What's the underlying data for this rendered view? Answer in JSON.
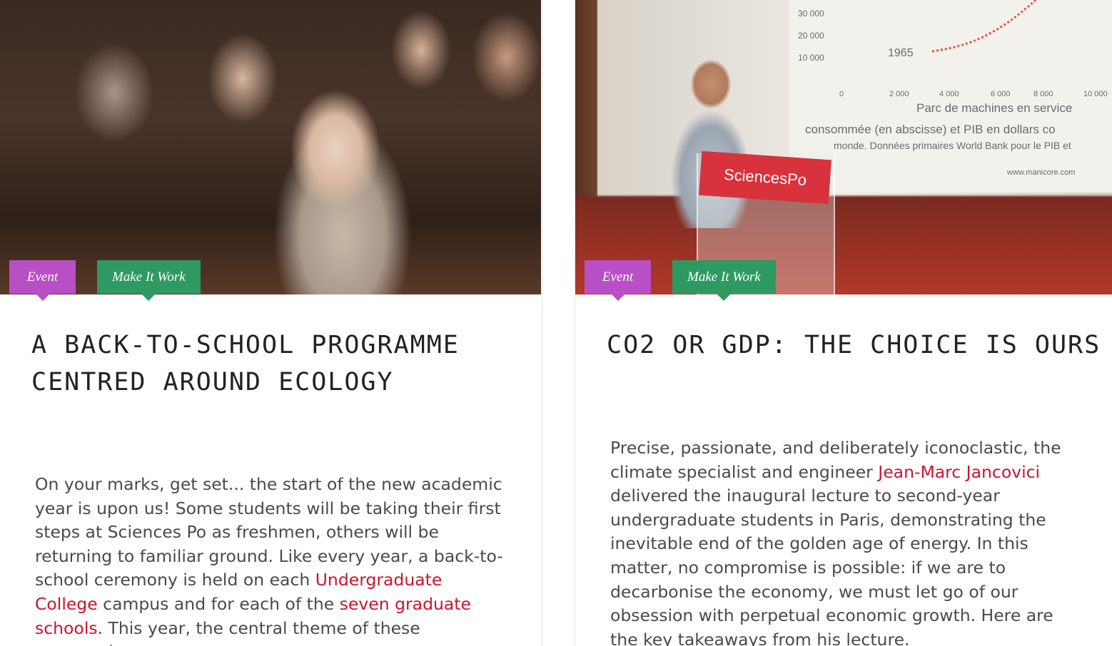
{
  "articles": [
    {
      "tags": [
        "Event",
        "Make It Work"
      ],
      "title": "A BACK-TO-SCHOOL PROGRAMME CENTRED AROUND ECOLOGY",
      "body": {
        "t1": "On your marks, get set... the start of the new academic year is upon us! Some students will be taking their first steps at Sciences Po as freshmen, others will be returning to familiar ground. Like every year, a back-to-school ceremony is held on each ",
        "link1": "Undergraduate College",
        "t2": " campus and for each of the ",
        "link2": "seven graduate schools",
        "t3": ". This year, the central theme of these ceremonies"
      }
    },
    {
      "tags": [
        "Event",
        "Make It Work"
      ],
      "title": "CO2 OR GDP: THE CHOICE IS OURS",
      "photo_text": {
        "axis_30000": "30 000",
        "axis_20000": "20 000",
        "axis_10000": "10 000",
        "year": "1965",
        "x_ticks": [
          "0",
          "2 000",
          "4 000",
          "6 000",
          "8 000",
          "10 000"
        ],
        "x_label": "Parc de machines en service",
        "caption1": "consommée (en abscisse) et PIB en dollars co",
        "caption2": "monde.  Données primaires World Bank pour le PIB et",
        "source": "www.manicore.com",
        "podium": "SciencesPo"
      },
      "body": {
        "t1": "Precise, passionate, and deliberately iconoclastic, the climate specialist and engineer ",
        "link1": "Jean-Marc Jancovici",
        "t2": " delivered the inaugural lecture to second-year undergraduate students in Paris, demonstrating the inevitable end of the golden age of energy. In this matter, no compromise is possible: if we are to decarbonise the economy, we must let go of our obsession with perpetual economic growth. Here are the key takeaways from his lecture."
      }
    }
  ],
  "colors": {
    "event_tag": "#b94fc6",
    "make_it_work_tag": "#2e9a62",
    "link": "#d0132b",
    "title": "#222222",
    "body": "#4a4a4a"
  }
}
